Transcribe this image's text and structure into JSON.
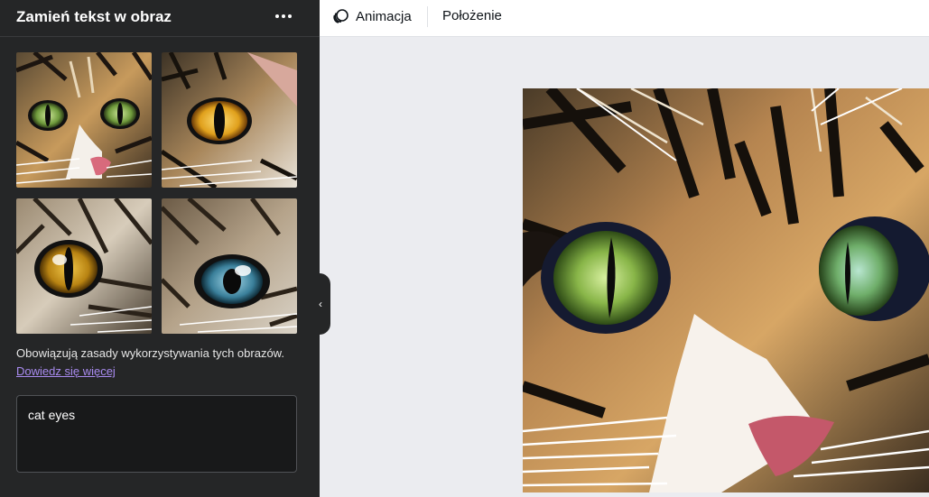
{
  "sidebar": {
    "title": "Zamień tekst w obraz",
    "notice": "Obowiązują zasady wykorzystywania tych obrazów.",
    "learn_more": "Dowiedz się więcej",
    "prompt_value": "cat eyes",
    "thumbnails": [
      {
        "icon": "cat-eyes-green-image"
      },
      {
        "icon": "cat-eye-amber-image"
      },
      {
        "icon": "cat-eye-yellow-image"
      },
      {
        "icon": "cat-eye-blue-image"
      }
    ]
  },
  "toolbar": {
    "animation_label": "Animacja",
    "position_label": "Położenie"
  },
  "colors": {
    "sidebar_bg": "#252627",
    "canvas_bg": "#ebecf0",
    "link": "#a98bf0"
  }
}
